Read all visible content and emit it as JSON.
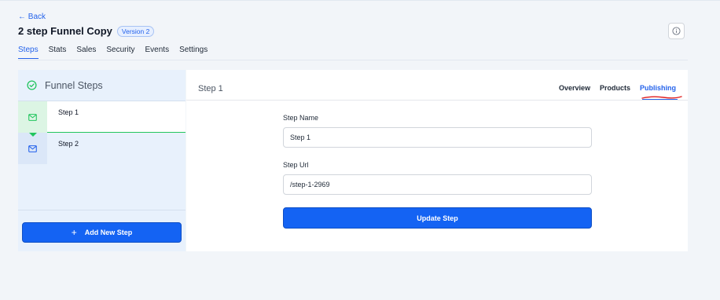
{
  "nav": {
    "back_label": "← Back"
  },
  "header": {
    "title": "2 step Funnel Copy",
    "version_badge": "Version 2"
  },
  "tabs": [
    {
      "label": "Steps",
      "active": true
    },
    {
      "label": "Stats"
    },
    {
      "label": "Sales"
    },
    {
      "label": "Security"
    },
    {
      "label": "Events"
    },
    {
      "label": "Settings"
    }
  ],
  "funnel_steps": {
    "title": "Funnel Steps",
    "steps": [
      {
        "label": "Step 1",
        "icon": "mail-icon",
        "active": true
      },
      {
        "label": "Step 2",
        "icon": "mail-icon",
        "active": false
      }
    ],
    "add_button_label": "Add New Step"
  },
  "step_detail": {
    "title": "Step 1",
    "tabs": [
      {
        "label": "Overview"
      },
      {
        "label": "Products"
      },
      {
        "label": "Publishing",
        "active": true
      }
    ],
    "step_name_label": "Step Name",
    "step_name_value": "Step 1",
    "step_url_label": "Step Url",
    "step_url_value": "/step-1-2969",
    "update_button_label": "Update Step"
  },
  "colors": {
    "accent": "#1463f3",
    "success": "#22c55e",
    "panel_bg": "#e8f1fc",
    "annotation": "#e11d1d"
  }
}
